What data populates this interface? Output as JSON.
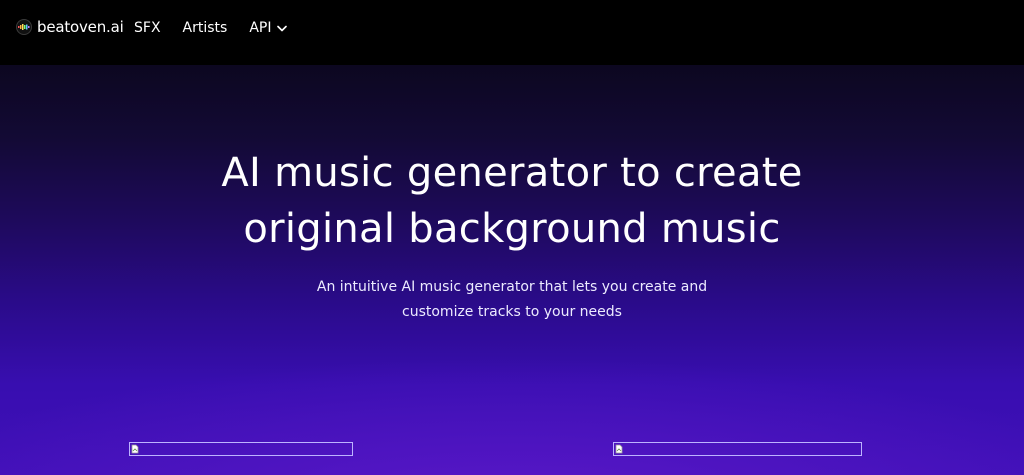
{
  "navbar": {
    "logo_text": "beatoven.ai",
    "links": [
      {
        "label": "SFX"
      },
      {
        "label": "Artists"
      },
      {
        "label": "API"
      }
    ]
  },
  "hero": {
    "title_line1": "AI music generator to create",
    "title_line2": "original background music",
    "subtitle_line1": "An intuitive AI music generator that lets you create and",
    "subtitle_line2": "customize tracks to your needs"
  },
  "icons": {
    "logo": "beatoven-logo-icon",
    "api_dropdown": "chevron-down-icon",
    "broken_image": "broken-image-icon"
  },
  "colors": {
    "navbar_bg": "#000000",
    "hero_top": "#0c0720",
    "hero_bottom": "#4010b8",
    "text": "#ffffff"
  }
}
